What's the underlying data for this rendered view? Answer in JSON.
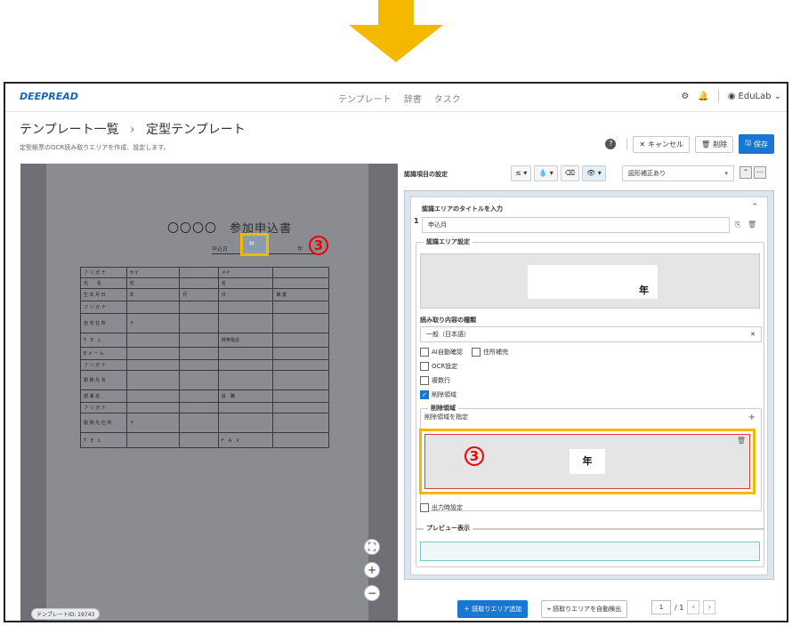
{
  "app": {
    "brand": "DEEPREAD",
    "user": "EduLab"
  },
  "nav": {
    "items": [
      "テンプレート",
      "辞書",
      "タスク"
    ]
  },
  "header": {
    "breadcrumb_root": "テンプレート一覧",
    "breadcrumb_sep": "›",
    "breadcrumb_current": "定型テンプレート",
    "subtitle": "定型帳票のOCR読み取りエリアを作成、設定します。",
    "help": "?",
    "cancel_label": "キャンセル",
    "delete_label": "削除",
    "save_label": "保存"
  },
  "document": {
    "title": "〇〇〇〇　参加申込書",
    "date_label": "申込日",
    "nen": "年",
    "form_rows": [
      [
        "フ リ ガ ナ",
        "セイ",
        "",
        "メイ",
        ""
      ],
      [
        "氏　　名",
        "姓",
        "",
        "名",
        ""
      ],
      [
        "生 年 月 日",
        "年",
        "月",
        "日",
        "職 業"
      ],
      [
        "フ リ ガ ナ",
        "",
        "",
        "",
        ""
      ],
      [
        "自 宅 住 所",
        "〒",
        "",
        "",
        ""
      ],
      [
        "T　E　L",
        "",
        "",
        "携帯電話",
        ""
      ],
      [
        "E メ ー ル",
        "",
        "",
        "",
        ""
      ],
      [
        "フ リ ガ ナ",
        "",
        "",
        "",
        ""
      ],
      [
        "勤 務 先 名",
        "",
        "",
        "",
        ""
      ],
      [
        "部 署 名",
        "",
        "",
        "役　職",
        ""
      ],
      [
        "フ リ ガ ナ",
        "",
        "",
        "",
        ""
      ],
      [
        "勤 務 先 住 所",
        "〒",
        "",
        "",
        ""
      ],
      [
        "T　E　L",
        "",
        "",
        "F　A　X",
        ""
      ]
    ],
    "template_id": "テンプレートID: 19743",
    "annotation": "3"
  },
  "panel": {
    "title": "認識項目の設定",
    "correction": "図形補正あり",
    "area_title_label": "認識エリアのタイトルを入力",
    "index": "1",
    "area_title_value": "申込月",
    "area_settings_label": "認識エリア設定",
    "preview_text": "年",
    "read_type_label": "読み取り内容の種類",
    "read_type_value": "一般（日本語）",
    "checks": [
      {
        "label": "AI自動確認",
        "checked": false
      },
      {
        "label": "住所補完",
        "checked": false
      },
      {
        "label": "OCR設定",
        "checked": false
      },
      {
        "label": "複数行",
        "checked": false
      },
      {
        "label": "削除領域",
        "checked": true
      }
    ],
    "delete_area_label": "削除領域",
    "delete_area_hint": "削除領域を指定",
    "delete_area_text": "年",
    "output_label": "出力時設定",
    "preview_label": "プレビュー表示"
  },
  "bottom": {
    "add_area": "読取りエリア追加",
    "auto_detect": "読取りエリアを自動検出",
    "page_current": "1",
    "page_total": "/ 1"
  },
  "colors": {
    "accent": "#1976d2",
    "highlight": "#f5b800",
    "marker": "#e00000",
    "arrow": "#f5b800"
  }
}
